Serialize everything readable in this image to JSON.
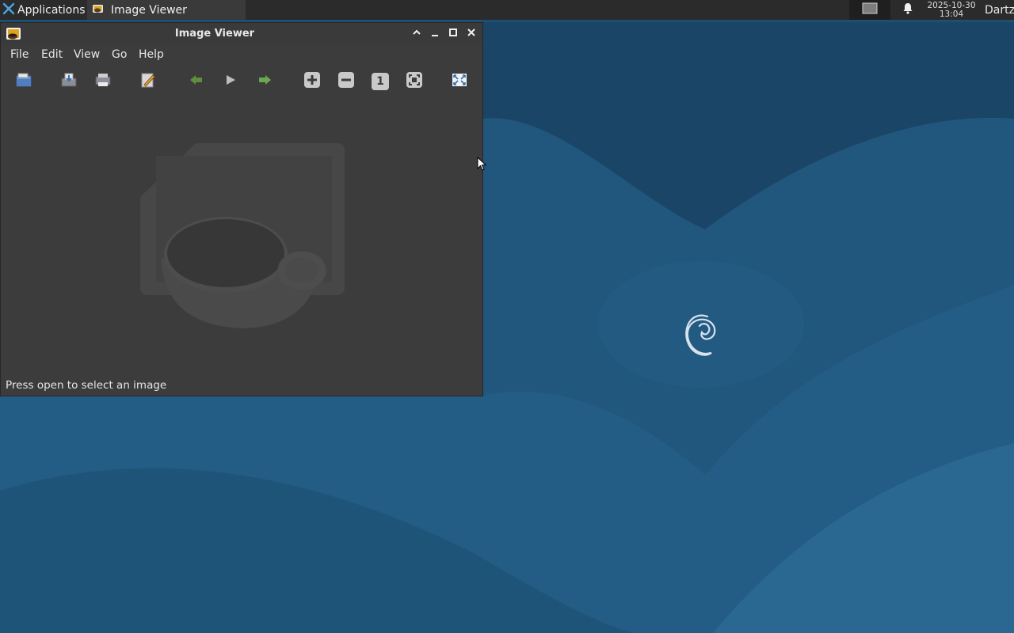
{
  "panel": {
    "applications_label": "Applications",
    "task_label": "Image Viewer",
    "clock_date": "2025-10-30",
    "clock_time": "13:04",
    "user_label": "Dartz"
  },
  "window": {
    "title": "Image Viewer",
    "menu": [
      "File",
      "Edit",
      "View",
      "Go",
      "Help"
    ],
    "toolbar": [
      {
        "name": "open-icon"
      },
      {
        "name": "save-icon"
      },
      {
        "name": "print-icon"
      },
      {
        "name": "edit-icon"
      },
      {
        "name": "back-icon"
      },
      {
        "name": "play-icon"
      },
      {
        "name": "forward-icon"
      },
      {
        "name": "zoom-in-icon"
      },
      {
        "name": "zoom-out-icon"
      },
      {
        "name": "zoom-100-icon"
      },
      {
        "name": "zoom-fit-icon"
      },
      {
        "name": "fullscreen-icon"
      }
    ],
    "zoom_100_glyph": "1",
    "status": "Press open to select an image"
  },
  "colors": {
    "wallpaper": "#1f5478",
    "panel": "#2b2b2b",
    "window_bg": "#3c3c3c",
    "accent_green": "#6aa84f"
  }
}
